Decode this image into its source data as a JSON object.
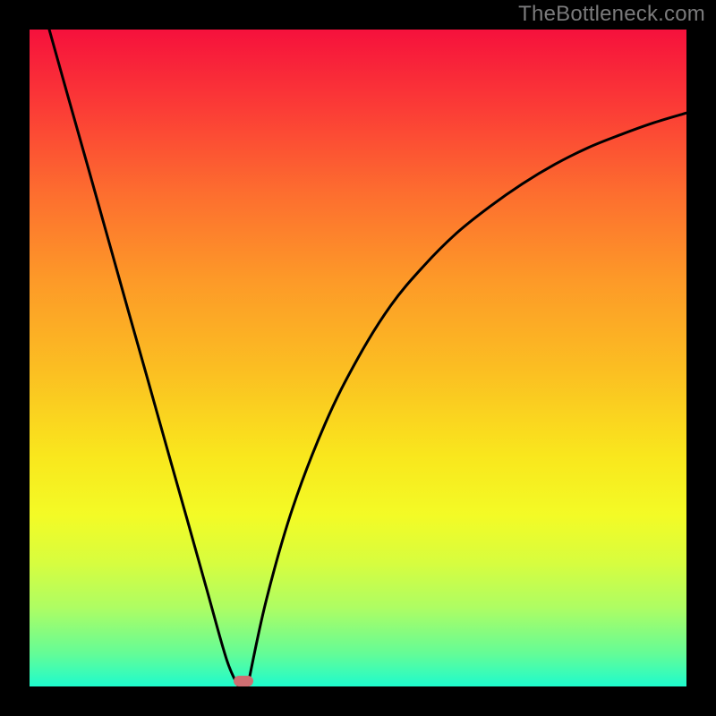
{
  "watermark": "TheBottleneck.com",
  "marker": {
    "x_pct": 32.5,
    "y_pct": 99.2,
    "color": "#cf6e72"
  },
  "chart_data": {
    "type": "line",
    "title": "",
    "xlabel": "",
    "ylabel": "",
    "xlim": [
      0,
      100
    ],
    "ylim": [
      0,
      100
    ],
    "grid": false,
    "legend": false,
    "background": "rainbow-gradient (red top to green bottom)",
    "annotations": [
      {
        "type": "marker",
        "x": 32.5,
        "y": 0.8,
        "shape": "pill",
        "color": "#cf6e72"
      }
    ],
    "series": [
      {
        "name": "left-branch",
        "x": [
          3,
          6,
          9,
          12,
          15,
          18,
          21,
          24,
          27,
          30,
          31.8
        ],
        "y": [
          100,
          89.3,
          78.7,
          68.0,
          57.3,
          46.7,
          36.0,
          25.4,
          14.7,
          4.1,
          0
        ],
        "stroke": "#000000",
        "stroke_width": 3
      },
      {
        "name": "right-branch",
        "x": [
          33.2,
          36,
          40,
          45,
          50,
          55,
          60,
          65,
          70,
          75,
          80,
          85,
          90,
          95,
          100
        ],
        "y": [
          0,
          13,
          27,
          40,
          50,
          58,
          64,
          69,
          73,
          76.5,
          79.5,
          82,
          84,
          85.8,
          87.3
        ],
        "stroke": "#000000",
        "stroke_width": 3
      }
    ]
  }
}
